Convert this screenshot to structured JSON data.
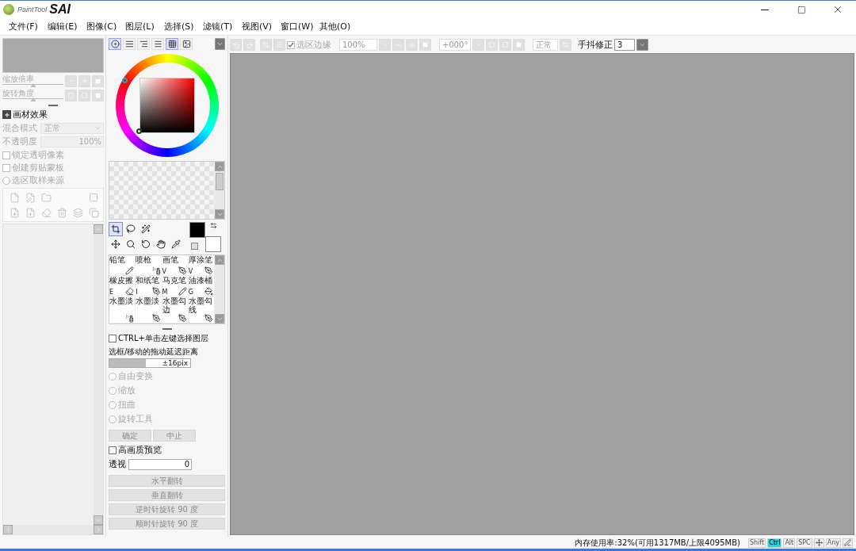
{
  "window": {
    "logo_small": "PaintTool",
    "logo_large": "SAI"
  },
  "menu": [
    "文件(F)",
    "编辑(E)",
    "图像(C)",
    "图层(L)",
    "选择(S)",
    "滤镜(T)",
    "视图(V)",
    "窗口(W)",
    "其他(O)"
  ],
  "navigator": {
    "sliders": [
      {
        "label": "缩放倍率",
        "level": 0.5
      },
      {
        "label": "旋转角度",
        "level": 0.5
      }
    ]
  },
  "layer_props": {
    "title": "画材效果",
    "blend_label": "混合模式",
    "blend_value": "正常",
    "opacity_label": "不透明度",
    "opacity_value": "100%",
    "options": [
      {
        "kind": "checkbox",
        "label": "锁定透明像素",
        "checked": false
      },
      {
        "kind": "checkbox",
        "label": "创建剪贴蒙板",
        "checked": false
      },
      {
        "kind": "radio",
        "label": "选区取样来源",
        "checked": false
      }
    ]
  },
  "color_tabs": [
    {
      "kind": "wheel",
      "selected": true
    },
    {
      "kind": "rgb",
      "selected": false
    },
    {
      "kind": "hsv",
      "selected": false
    },
    {
      "kind": "mixer",
      "selected": false
    },
    {
      "kind": "swatches",
      "selected": true
    },
    {
      "kind": "scratch",
      "selected": false
    }
  ],
  "tool_rows": [
    [
      {
        "kind": "select",
        "selected": true
      },
      {
        "kind": "lasso",
        "selected": false
      },
      {
        "kind": "wand",
        "selected": false
      }
    ],
    [
      {
        "kind": "move",
        "selected": false
      },
      {
        "kind": "zoom",
        "selected": false
      },
      {
        "kind": "rotate",
        "selected": false
      },
      {
        "kind": "hand",
        "selected": false
      },
      {
        "kind": "dropper",
        "selected": false
      }
    ]
  ],
  "brushes": [
    {
      "name": "铅笔",
      "kind": "pencil"
    },
    {
      "name": "喷枪",
      "kind": "spray"
    },
    {
      "name": "画笔",
      "key": "V",
      "kind": "pen"
    },
    {
      "name": "厚涂笔",
      "key": "V",
      "kind": "pen"
    },
    {
      "name": "橡皮擦",
      "key": "E",
      "kind": "eraser"
    },
    {
      "name": "和纸笔",
      "key": "I",
      "kind": "pen"
    },
    {
      "name": "马克笔",
      "key": "M",
      "kind": "pencil"
    },
    {
      "name": "油漆桶",
      "key": "G",
      "kind": "bucket"
    },
    {
      "name": "水墨淡",
      "kind": "spray"
    },
    {
      "name": "水墨淡",
      "kind": "pen"
    },
    {
      "name": "水墨勾边",
      "kind": "pen"
    },
    {
      "name": "水墨勾线",
      "kind": "pen"
    }
  ],
  "transform": {
    "ctrl_label": "CTRL+单击左键选择图层",
    "ctrl_checked": false,
    "drag": {
      "label": "选框/移动的拖动延迟距离",
      "value": "±16pix",
      "level": 0.45
    },
    "modes": [
      {
        "label": "自由变换",
        "selected": false
      },
      {
        "label": "缩放",
        "selected": false
      },
      {
        "label": "扭曲",
        "selected": false
      },
      {
        "label": "旋转工具",
        "selected": false
      }
    ],
    "actions": [
      "确定",
      "中止"
    ],
    "hq_label": "高画质预览",
    "hq_checked": false,
    "perspective_label": "透视",
    "perspective_value": "0",
    "flips": [
      "水平翻转",
      "垂直翻转",
      "逆时针旋转 90 度",
      "顺时针旋转 90 度"
    ]
  },
  "toolbar": {
    "edge_label": "选区边缘",
    "edge_checked": true,
    "zoom": "100%",
    "angle": "+000°",
    "mode": "正常",
    "stabilizer_label": "手抖修正",
    "stabilizer_value": "3"
  },
  "status": {
    "memory": "内存使用率:32%(可用1317MB/上限4095MB)",
    "keys": [
      {
        "label": "Shift",
        "on": false
      },
      {
        "label": "Ctrl",
        "on": true
      },
      {
        "label": "Alt",
        "on": false
      },
      {
        "label": "SPC",
        "on": false
      }
    ],
    "any_key": {
      "label": "Any",
      "on": false
    }
  }
}
